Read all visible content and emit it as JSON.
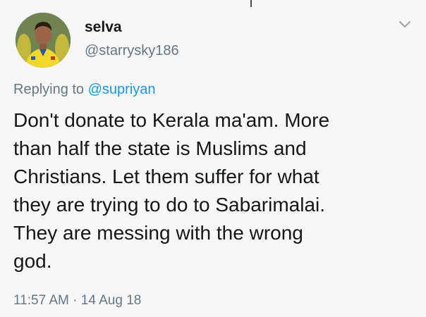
{
  "author": {
    "display_name": "selva",
    "username": "@starrysky186"
  },
  "reply": {
    "prefix": "Replying to ",
    "mention": "@supriyan"
  },
  "tweet": {
    "lines": [
      "Don't donate to Kerala ma'am. More",
      "than half the state is Muslims and",
      "Christians. Let them suffer for what",
      "they are trying to do to Sabarimalai.",
      "They are messing with the wrong",
      "god."
    ],
    "timestamp": "11:57 AM · 14 Aug 18"
  },
  "icons": {
    "menu": "chevron-down-icon",
    "avatar": "profile-photo"
  },
  "colors": {
    "background": "#f7f7f7",
    "text": "#14171a",
    "secondary": "#657786",
    "link": "#1b95e0"
  }
}
